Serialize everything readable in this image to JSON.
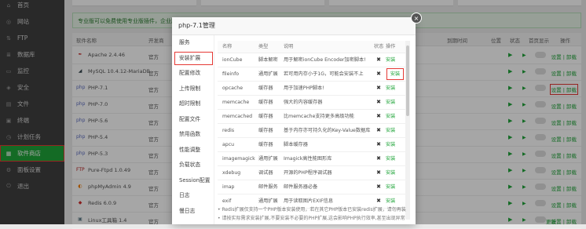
{
  "sidebar": {
    "items": [
      {
        "label": "首页",
        "icon": "home-icon",
        "glyph": "⌂"
      },
      {
        "label": "网站",
        "icon": "globe-icon",
        "glyph": "◎"
      },
      {
        "label": "FTP",
        "icon": "ftp-icon",
        "glyph": "⇅"
      },
      {
        "label": "数据库",
        "icon": "database-icon",
        "glyph": "≣"
      },
      {
        "label": "监控",
        "icon": "monitor-icon",
        "glyph": "▭"
      },
      {
        "label": "安全",
        "icon": "shield-icon",
        "glyph": "◈"
      },
      {
        "label": "文件",
        "icon": "folder-icon",
        "glyph": "▤"
      },
      {
        "label": "终端",
        "icon": "terminal-icon",
        "glyph": "▣"
      },
      {
        "label": "计划任务",
        "icon": "clock-icon",
        "glyph": "◷"
      },
      {
        "label": "软件商店",
        "icon": "store-icon",
        "glyph": "▦"
      },
      {
        "label": "面板设置",
        "icon": "gear-icon",
        "glyph": "⚙"
      },
      {
        "label": "退出",
        "icon": "exit-icon",
        "glyph": "⏻"
      }
    ]
  },
  "notice": "专业版可以免费使用专业版插件，企业版",
  "list": {
    "headers": [
      "软件名称",
      "开发商",
      "到期时间",
      "位置",
      "状态",
      "首页显示",
      "操作"
    ],
    "rows": [
      {
        "name": "Apache 2.4.46",
        "dev": "官方",
        "icon": "apache-icon",
        "glyph": "✒",
        "color": "#c62828",
        "ops": "设置 | 卸载"
      },
      {
        "name": "MySQL 10.4.12-MariaDB",
        "dev": "官方",
        "icon": "mysql-icon",
        "glyph": "◢",
        "color": "#37474f",
        "ops": "设置 | 卸载"
      },
      {
        "name": "PHP-7.1",
        "dev": "官方",
        "icon": "php-icon",
        "glyph": "php",
        "color": "#5c6bc0",
        "ops": "设置 | 卸载"
      },
      {
        "name": "PHP-7.0",
        "dev": "官方",
        "icon": "php-icon",
        "glyph": "php",
        "color": "#5c6bc0",
        "ops": "设置 | 卸载"
      },
      {
        "name": "PHP-5.6",
        "dev": "官方",
        "icon": "php-icon",
        "glyph": "php",
        "color": "#5c6bc0",
        "ops": "设置 | 卸载"
      },
      {
        "name": "PHP-5.4",
        "dev": "官方",
        "icon": "php-icon",
        "glyph": "php",
        "color": "#5c6bc0",
        "ops": "设置 | 卸载"
      },
      {
        "name": "PHP-5.3",
        "dev": "官方",
        "icon": "php-icon",
        "glyph": "php",
        "color": "#5c6bc0",
        "ops": "设置 | 卸载"
      },
      {
        "name": "Pure-Ftpd 1.0.49",
        "dev": "官方",
        "icon": "ftpd-icon",
        "glyph": "FTP",
        "color": "#b71c1c",
        "ops": "设置 | 卸载"
      },
      {
        "name": "phpMyAdmin 4.9",
        "dev": "官方",
        "icon": "phpmyadmin-icon",
        "glyph": "◐",
        "color": "#f57c00",
        "ops": "设置 | 卸载"
      },
      {
        "name": "Redis 6.0.9",
        "dev": "官方",
        "icon": "redis-icon",
        "glyph": "◆",
        "color": "#d32f2f",
        "ops": "设置 | 卸载"
      },
      {
        "name": "Linux工具箱 1.4",
        "dev": "官方",
        "icon": "toolbox-icon",
        "glyph": "▣",
        "color": "#607d8b",
        "ops": "设置 | 卸载",
        "update": "更新"
      }
    ]
  },
  "modal": {
    "title": "php-7.1管理",
    "close": "×",
    "nav": [
      "服务",
      "安装扩展",
      "配置修改",
      "上传限制",
      "超时限制",
      "配置文件",
      "禁用函数",
      "性能调整",
      "负载状态",
      "Session配置",
      "日志",
      "慢日志"
    ],
    "headers": [
      "名称",
      "类型",
      "说明",
      "状态",
      "操作"
    ],
    "rows": [
      {
        "name": "ionCube",
        "type": "脚本解密",
        "desc": "用于解密ionCube Encoder加密脚本!",
        "status": "✖",
        "op": "安装"
      },
      {
        "name": "fileinfo",
        "type": "通用扩展",
        "desc": "若可用内存小于1G，可能会安装不上",
        "status": "✖",
        "op": "安装"
      },
      {
        "name": "opcache",
        "type": "缓存器",
        "desc": "用于加速PHP脚本!",
        "status": "✖",
        "op": "安装"
      },
      {
        "name": "memcache",
        "type": "缓存器",
        "desc": "强大的内容缓存器",
        "status": "✖",
        "op": "安装"
      },
      {
        "name": "memcached",
        "type": "缓存器",
        "desc": "比memcache支持更多高级功能",
        "status": "✖",
        "op": "安装"
      },
      {
        "name": "redis",
        "type": "缓存器",
        "desc": "基于内存亦可持久化的Key-Value数据库",
        "status": "✖",
        "op": "安装"
      },
      {
        "name": "apcu",
        "type": "缓存器",
        "desc": "脚本缓存器",
        "status": "✖",
        "op": "安装"
      },
      {
        "name": "imagemagick",
        "type": "通用扩展",
        "desc": "Imagick高性能图形库",
        "status": "✖",
        "op": "安装"
      },
      {
        "name": "xdebug",
        "type": "调试器",
        "desc": "开源的PHP程序调试器",
        "status": "✖",
        "op": "安装"
      },
      {
        "name": "imap",
        "type": "邮件服务",
        "desc": "邮件服务器必备",
        "status": "✖",
        "op": "安装"
      },
      {
        "name": "exif",
        "type": "通用扩展",
        "desc": "用于读取图片EXIF信息",
        "status": "✖",
        "op": "安装"
      }
    ],
    "notes": [
      "• Redis扩展仅支持一个PHP版本安装使用，若在其它PHP版本已安装redis扩展，请勿再装",
      "• 请按实际需求安装扩展,不要安装不必要的PHP扩展,这会影响PHP执行效率,甚至出现异常"
    ]
  }
}
